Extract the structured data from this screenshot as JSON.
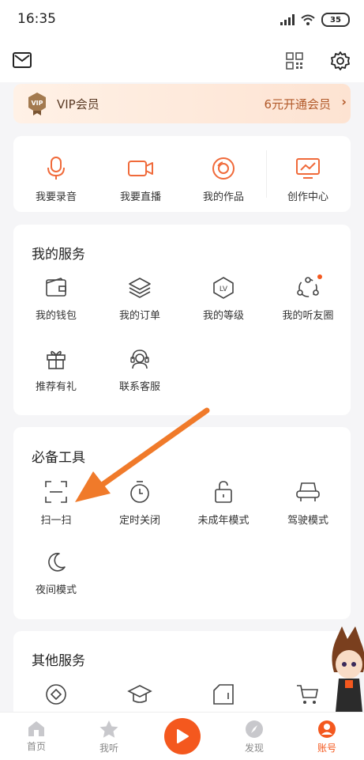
{
  "status": {
    "time": "16:35",
    "battery": "35"
  },
  "vip": {
    "label": "VIP会员",
    "cta": "6元开通会员",
    "badge": "VIP"
  },
  "quick_actions": [
    {
      "label": "我要录音"
    },
    {
      "label": "我要直播"
    },
    {
      "label": "我的作品"
    },
    {
      "label": "创作中心"
    }
  ],
  "services": {
    "title": "我的服务",
    "items": [
      {
        "label": "我的钱包"
      },
      {
        "label": "我的订单"
      },
      {
        "label": "我的等级"
      },
      {
        "label": "我的听友圈"
      },
      {
        "label": "推荐有礼"
      },
      {
        "label": "联系客服"
      }
    ]
  },
  "tools": {
    "title": "必备工具",
    "items": [
      {
        "label": "扫一扫"
      },
      {
        "label": "定时关闭"
      },
      {
        "label": "未成年模式"
      },
      {
        "label": "驾驶模式"
      },
      {
        "label": "夜间模式"
      }
    ]
  },
  "other": {
    "title": "其他服务"
  },
  "nav": [
    {
      "label": "首页"
    },
    {
      "label": "我听"
    },
    {
      "label": "发现"
    },
    {
      "label": "账号"
    }
  ],
  "colors": {
    "accent": "#f4581e",
    "arrow": "#f07a2a"
  }
}
